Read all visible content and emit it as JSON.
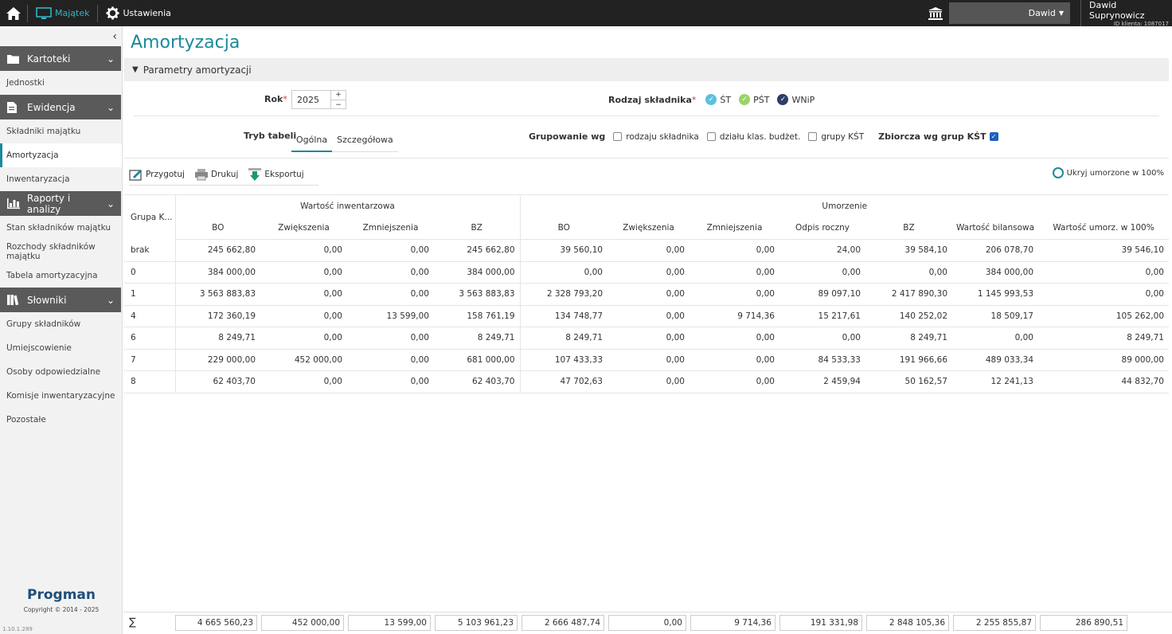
{
  "topbar": {
    "majatek_label": "Majątek",
    "ustawienia_label": "Ustawienia",
    "user_select": "Dawid",
    "account_name": "Dawid Suprynowicz",
    "client_id": "ID klienta: 1087017"
  },
  "sidebar": {
    "sections": [
      {
        "label": "Kartoteki",
        "items": [
          "Jednostki"
        ]
      },
      {
        "label": "Ewidencja",
        "items": [
          "Składniki majątku",
          "Amortyzacja",
          "Inwentaryzacja"
        ]
      },
      {
        "label": "Raporty i analizy",
        "items": [
          "Stan składników majątku",
          "Rozchody składników majątku",
          "Tabela amortyzacyjna"
        ]
      },
      {
        "label": "Słowniki",
        "items": [
          "Grupy składników",
          "Umiejscowienie",
          "Osoby odpowiedzialne",
          "Komisje inwentaryzacyjne",
          "Pozostałe"
        ]
      }
    ],
    "active_item": "Amortyzacja",
    "brand": "Progman",
    "copyright": "Copyright © 2014 - 2025",
    "version": "1.10.1.289"
  },
  "page": {
    "title": "Amortyzacja",
    "params_label": "Parametry amortyzacji",
    "rok_label": "Rok",
    "rok_value": "2025",
    "rodzaj_label": "Rodzaj składnika",
    "rodzaj_options": [
      {
        "label": "ŚT",
        "color": "#5bc0de"
      },
      {
        "label": "PŚT",
        "color": "#9bd36a"
      },
      {
        "label": "WNiP",
        "color": "#2c3e66"
      }
    ],
    "tryb_label": "Tryb tabeli",
    "tabs": [
      "Ogólna",
      "Szczegółowa"
    ],
    "grupowanie_label": "Grupowanie wg",
    "grupowanie_options": [
      "rodzaju składnika",
      "działu klas. budżet.",
      "grupy KŚT"
    ],
    "zbiorcza_label": "Zbiorcza wg grup KŚT",
    "tools": {
      "prepare": "Przygotuj",
      "print": "Drukuj",
      "export": "Eksportuj"
    },
    "hide_label": "Ukryj umorzone w 100%"
  },
  "table": {
    "corner": "Grupa K...",
    "group_headers": [
      "Wartość inwentarzowa",
      "Umorzenie"
    ],
    "columns": [
      "BO",
      "Zwiększenia",
      "Zmniejszenia",
      "BZ",
      "BO",
      "Zwiększenia",
      "Zmniejszenia",
      "Odpis roczny",
      "BZ",
      "Wartość bilansowa",
      "Wartość umorz. w 100%"
    ],
    "rows": [
      {
        "group": "brak",
        "values": [
          "245 662,80",
          "0,00",
          "0,00",
          "245 662,80",
          "39 560,10",
          "0,00",
          "0,00",
          "24,00",
          "39 584,10",
          "206 078,70",
          "39 546,10"
        ]
      },
      {
        "group": "0",
        "values": [
          "384 000,00",
          "0,00",
          "0,00",
          "384 000,00",
          "0,00",
          "0,00",
          "0,00",
          "0,00",
          "0,00",
          "384 000,00",
          "0,00"
        ]
      },
      {
        "group": "1",
        "values": [
          "3 563 883,83",
          "0,00",
          "0,00",
          "3 563 883,83",
          "2 328 793,20",
          "0,00",
          "0,00",
          "89 097,10",
          "2 417 890,30",
          "1 145 993,53",
          "0,00"
        ]
      },
      {
        "group": "4",
        "values": [
          "172 360,19",
          "0,00",
          "13 599,00",
          "158 761,19",
          "134 748,77",
          "0,00",
          "9 714,36",
          "15 217,61",
          "140 252,02",
          "18 509,17",
          "105 262,00"
        ]
      },
      {
        "group": "6",
        "values": [
          "8 249,71",
          "0,00",
          "0,00",
          "8 249,71",
          "8 249,71",
          "0,00",
          "0,00",
          "0,00",
          "8 249,71",
          "0,00",
          "8 249,71"
        ]
      },
      {
        "group": "7",
        "values": [
          "229 000,00",
          "452 000,00",
          "0,00",
          "681 000,00",
          "107 433,33",
          "0,00",
          "0,00",
          "84 533,33",
          "191 966,66",
          "489 033,34",
          "89 000,00"
        ]
      },
      {
        "group": "8",
        "values": [
          "62 403,70",
          "0,00",
          "0,00",
          "62 403,70",
          "47 702,63",
          "0,00",
          "0,00",
          "2 459,94",
          "50 162,57",
          "12 241,13",
          "44 832,70"
        ]
      }
    ],
    "sigma": "∑",
    "sums": [
      "4 665 560,23",
      "452 000,00",
      "13 599,00",
      "5 103 961,23",
      "2 666 487,74",
      "0,00",
      "9 714,36",
      "191 331,98",
      "2 848 105,36",
      "2 255 855,87",
      "286 890,51"
    ]
  }
}
